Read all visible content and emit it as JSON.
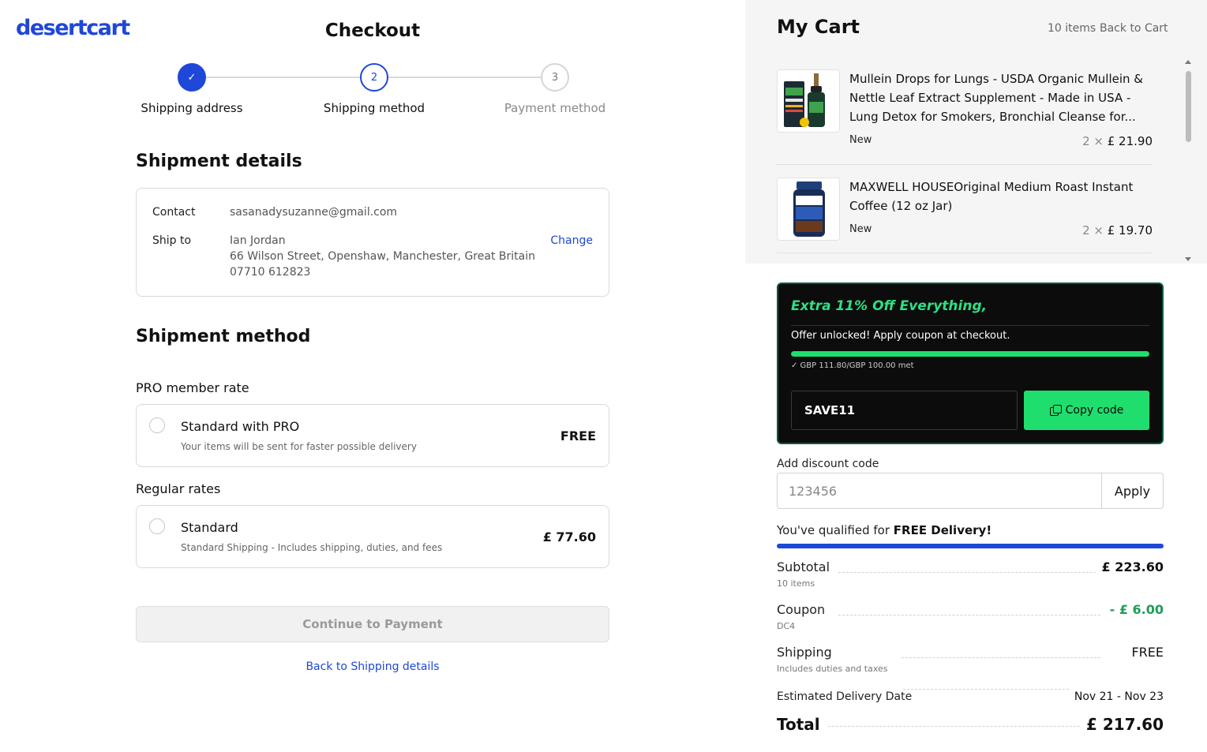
{
  "brand": {
    "logo_text": "desertcart",
    "color": "#1f47d8"
  },
  "page": {
    "title": "Checkout"
  },
  "stepper": {
    "steps": [
      {
        "number": "✓",
        "label": "Shipping address",
        "state": "done"
      },
      {
        "number": "2",
        "label": "Shipping method",
        "state": "active"
      },
      {
        "number": "3",
        "label": "Payment method",
        "state": "todo"
      }
    ]
  },
  "shipment_details": {
    "title": "Shipment details",
    "contact_label": "Contact",
    "contact_value": "sasanadysuzanne@gmail.com",
    "ship_to_label": "Ship to",
    "ship_name": "Ian Jordan",
    "ship_address": "66 Wilson Street, Openshaw, Manchester, Great Britain",
    "ship_phone": "07710 612823",
    "change_label": "Change"
  },
  "shipment_method": {
    "title": "Shipment method",
    "pro_group_label": "PRO member rate",
    "pro_option": {
      "name": "Standard with PRO",
      "description": "Your items will be sent for faster possible delivery",
      "price": "FREE"
    },
    "regular_group_label": "Regular rates",
    "regular_option": {
      "name": "Standard",
      "description": "Standard Shipping - Includes shipping, duties, and fees",
      "price": "£ 77.60"
    }
  },
  "actions": {
    "continue_label": "Continue to Payment",
    "back_label": "Back to Shipping details"
  },
  "cart": {
    "title": "My Cart",
    "count": "10 items",
    "back_label": "Back to Cart",
    "items": [
      {
        "name": "Mullein Drops for Lungs - USDA Organic Mullein & Nettle Leaf Extract Supplement - Made in USA - Lung Detox for Smokers, Bronchial Cleanse for...",
        "condition": "New",
        "qty": "2",
        "price": "£ 21.90",
        "thumb_icon": "mullein-drops-product-icon"
      },
      {
        "name": "MAXWELL HOUSEOriginal Medium Roast Instant Coffee (12 oz Jar)",
        "condition": "New",
        "qty": "2",
        "price": "£ 19.70",
        "thumb_icon": "coffee-jar-product-icon"
      }
    ]
  },
  "promo": {
    "title": "Extra 11% Off Everything,",
    "message": "Offer unlocked! Apply coupon at checkout.",
    "progress_text": "✓ GBP 111.80/GBP 100.00 met",
    "progress_fraction": 1.0,
    "code": "SAVE11",
    "copy_label": "Copy code",
    "accent": "#1fde6e"
  },
  "discount": {
    "label": "Add discount code",
    "placeholder": "123456",
    "apply_label": "Apply"
  },
  "delivery": {
    "qualify_prefix": "You've qualified for ",
    "qualify_bold": "FREE Delivery!",
    "progress_fraction": 1.0
  },
  "summary": {
    "subtotal_label": "Subtotal",
    "subtotal_sub": "10 items",
    "subtotal_value": "£ 223.60",
    "coupon_label": "Coupon",
    "coupon_sub": "DC4",
    "coupon_value": "- £ 6.00",
    "shipping_label": "Shipping",
    "shipping_sub": "Includes duties and taxes",
    "shipping_value": "FREE",
    "eta_label": "Estimated Delivery Date",
    "eta_value": "Nov 21 - Nov 23",
    "total_label": "Total",
    "total_value": "£ 217.60"
  }
}
